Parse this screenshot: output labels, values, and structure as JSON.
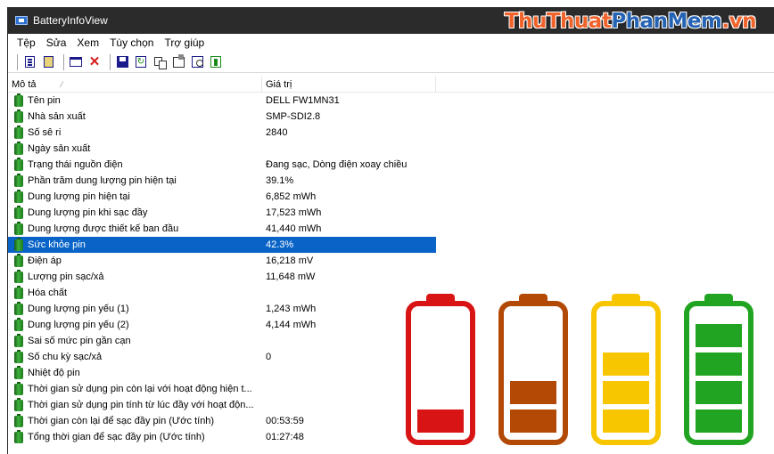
{
  "window": {
    "title": "BatteryInfoView",
    "watermark_orange": "ThuThuat",
    "watermark_blue": "PhanMem",
    "watermark_suffix": ".vn"
  },
  "menu": [
    "Tệp",
    "Sửa",
    "Xem",
    "Tùy chọn",
    "Trợ giúp"
  ],
  "toolbar": {
    "icons": [
      "battery-info-icon",
      "battery-log-icon",
      "options-icon",
      "delete-icon",
      "save-icon",
      "refresh-icon",
      "copy-icon",
      "properties-icon",
      "find-icon",
      "exit-icon"
    ]
  },
  "list": {
    "headers": {
      "description": "Mô tả",
      "value": "Giá trị"
    },
    "selected_index": 9,
    "rows": [
      {
        "label": "Tên pin",
        "value": "DELL FW1MN31"
      },
      {
        "label": "Nhà sản xuất",
        "value": "SMP-SDI2.8"
      },
      {
        "label": "Số sê ri",
        "value": " 2840"
      },
      {
        "label": "Ngày sản xuất",
        "value": ""
      },
      {
        "label": "Trạng thái nguồn điện",
        "value": "Đang sạc, Dòng điện xoay chiều"
      },
      {
        "label": "Phần trăm dung lượng pin hiện tại",
        "value": "39.1%"
      },
      {
        "label": "Dung lượng pin hiện tại",
        "value": "6,852 mWh"
      },
      {
        "label": "Dung lượng pin khi sạc đầy",
        "value": "17,523 mWh"
      },
      {
        "label": "Dung lượng được thiết kế ban đầu",
        "value": "41,440 mWh"
      },
      {
        "label": "Sức khỏe pin",
        "value": "42.3%"
      },
      {
        "label": "Điện áp",
        "value": "16,218 mV"
      },
      {
        "label": "Lượng pin sạc/xả",
        "value": "11,648 mW"
      },
      {
        "label": "Hóa chất",
        "value": ""
      },
      {
        "label": "Dung lượng pin yếu (1)",
        "value": "1,243 mWh"
      },
      {
        "label": "Dung lượng pin yếu (2)",
        "value": "4,144 mWh"
      },
      {
        "label": "Sai số mức pin gần cạn",
        "value": ""
      },
      {
        "label": "Số chu kỳ sạc/xả",
        "value": "0"
      },
      {
        "label": "Nhiệt độ pin",
        "value": ""
      },
      {
        "label": "Thời gian sử dụng pin còn lại với hoạt động hiện t...",
        "value": ""
      },
      {
        "label": "Thời gian sử dụng pin tính từ lúc đầy với hoạt độn...",
        "value": ""
      },
      {
        "label": "Thời gian còn lại để sạc đầy pin (Ước tính)",
        "value": "00:53:59"
      },
      {
        "label": "Tổng thời gian để sạc đầy pin (Ước tính)",
        "value": "01:27:48"
      }
    ]
  },
  "battery_graphic": [
    {
      "color": "#d81414",
      "bars": 1
    },
    {
      "color": "#b24a06",
      "bars": 2
    },
    {
      "color": "#f7c600",
      "bars": 3
    },
    {
      "color": "#21a421",
      "bars": 4
    }
  ]
}
